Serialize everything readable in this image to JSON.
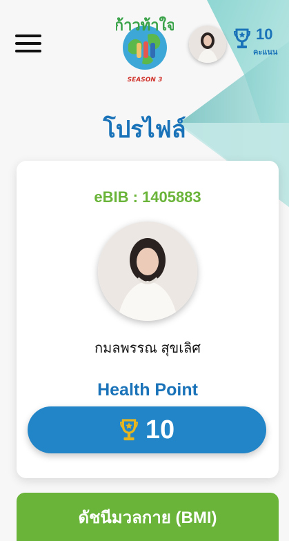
{
  "header": {
    "logo_text": "ก้าวท้าใจ",
    "logo_season": "SEASON 3",
    "score_value": "10",
    "score_unit": "คะแนน"
  },
  "page": {
    "title": "โปรไฟล์"
  },
  "profile": {
    "ebib": "eBIB : 1405883",
    "name": "กมลพรรณ สุขเลิศ",
    "health_point_label": "Health Point",
    "health_point_value": "10"
  },
  "bmi_button": {
    "label": "ดัชนีมวลกาย (BMI)"
  },
  "colors": {
    "brand_blue": "#1a73b8",
    "button_blue": "#2185c8",
    "brand_green": "#6ab43a",
    "teal_bg": "#8fd3cf",
    "trophy_gold": "#e7b61e"
  }
}
